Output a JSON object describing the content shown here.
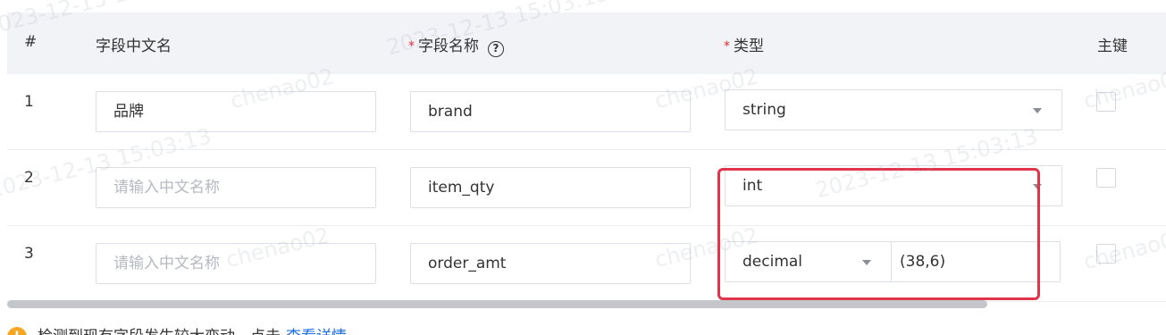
{
  "header": {
    "col_index": "#",
    "col_cn_name": "字段中文名",
    "col_field_name": "字段名称",
    "col_type": "类型",
    "col_pk": "主键",
    "required_mark": "*",
    "help_icon": "question-circle-icon"
  },
  "rows": [
    {
      "index": "1",
      "cn_name": "品牌",
      "cn_placeholder": "请输入中文名称",
      "field_name": "brand",
      "type": "string",
      "primary_key": false
    },
    {
      "index": "2",
      "cn_name": "",
      "cn_placeholder": "请输入中文名称",
      "field_name": "item_qty",
      "type": "int",
      "primary_key": false
    },
    {
      "index": "3",
      "cn_name": "",
      "cn_placeholder": "请输入中文名称",
      "field_name": "order_amt",
      "type": "decimal",
      "precision": "(38,6)",
      "primary_key": false
    }
  ],
  "notice": {
    "text": "检测到现有字段发生较大变动，点击",
    "link": "查看详情"
  },
  "watermark": {
    "user": "chenao02",
    "datetime": "2023-12-13 15:03:13"
  },
  "colors": {
    "highlight": "#e0354a",
    "required": "#f5222d",
    "link": "#1f6fe5",
    "header_bg": "#f2f3f7"
  }
}
